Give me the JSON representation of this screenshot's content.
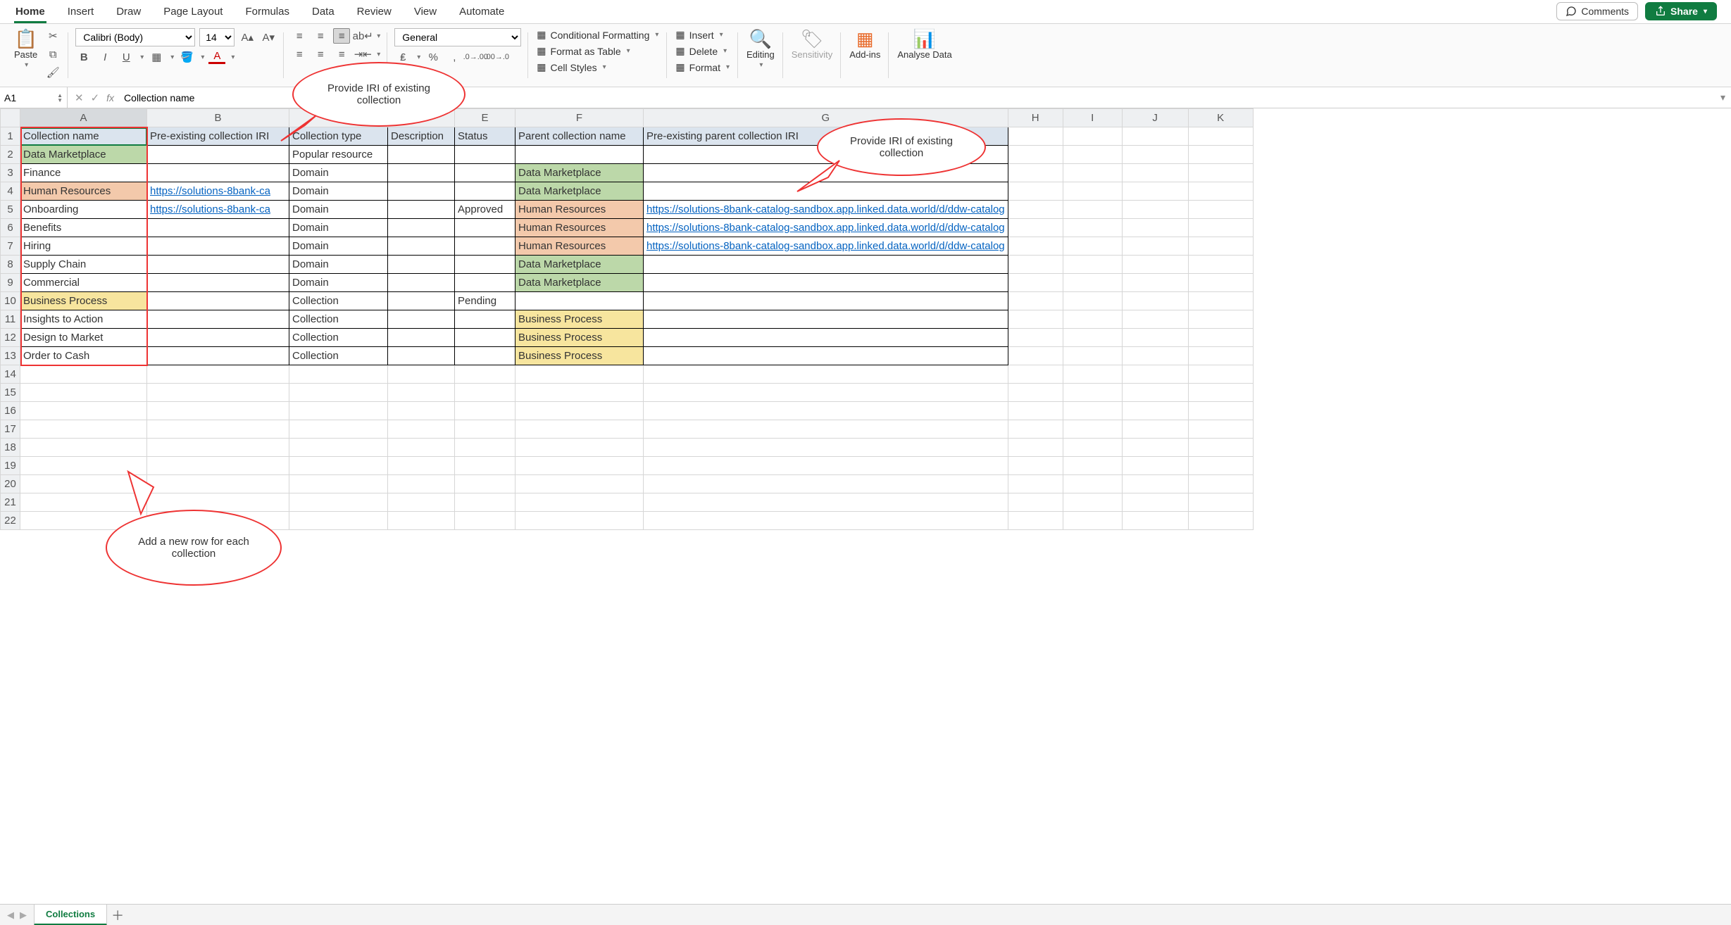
{
  "tabs": [
    "Home",
    "Insert",
    "Draw",
    "Page Layout",
    "Formulas",
    "Data",
    "Review",
    "View",
    "Automate"
  ],
  "active_tab": "Home",
  "top_right": {
    "comments": "Comments",
    "share": "Share"
  },
  "ribbon": {
    "paste": "Paste",
    "font_name": "Calibri (Body)",
    "font_size": "14",
    "number_format": "General",
    "styles": {
      "cond_fmt": "Conditional Formatting",
      "as_table": "Format as Table",
      "cell_styles": "Cell Styles"
    },
    "cells": {
      "insert": "Insert",
      "delete": "Delete",
      "format": "Format"
    },
    "editing": "Editing",
    "sensitivity": "Sensitivity",
    "addins": "Add-ins",
    "analyse": "Analyse Data"
  },
  "formula_bar": {
    "cell_ref": "A1",
    "formula": "Collection name"
  },
  "columns": [
    "A",
    "B",
    "C",
    "D",
    "E",
    "F",
    "G",
    "H",
    "I",
    "J",
    "K"
  ],
  "row_count": 22,
  "headers": {
    "A": "Collection name",
    "B": "Pre-existing collection IRI",
    "C": "Collection type",
    "D": "Description",
    "E": "Status",
    "F": "Parent collection name",
    "G": "Pre-existing parent collection IRI"
  },
  "data_rows": [
    {
      "A": {
        "v": "Data Marketplace",
        "fill": "green"
      },
      "C": {
        "v": "Popular resource"
      }
    },
    {
      "A": {
        "v": "Finance"
      },
      "C": {
        "v": "Domain"
      },
      "F": {
        "v": "Data Marketplace",
        "fill": "green"
      }
    },
    {
      "A": {
        "v": "Human Resources",
        "fill": "orange"
      },
      "B": {
        "v": "https://solutions-8bank-ca",
        "link": true
      },
      "C": {
        "v": "Domain"
      },
      "F": {
        "v": "Data Marketplace",
        "fill": "green"
      }
    },
    {
      "A": {
        "v": "Onboarding"
      },
      "B": {
        "v": "https://solutions-8bank-ca",
        "link": true
      },
      "C": {
        "v": "Domain"
      },
      "E": {
        "v": "Approved"
      },
      "F": {
        "v": "Human Resources",
        "fill": "orange"
      },
      "G": {
        "v": "https://solutions-8bank-catalog-sandbox.app.linked.data.world/d/ddw-catalog",
        "link": true
      }
    },
    {
      "A": {
        "v": "Benefits"
      },
      "C": {
        "v": "Domain"
      },
      "F": {
        "v": "Human Resources",
        "fill": "orange"
      },
      "G": {
        "v": "https://solutions-8bank-catalog-sandbox.app.linked.data.world/d/ddw-catalog",
        "link": true
      }
    },
    {
      "A": {
        "v": "Hiring"
      },
      "C": {
        "v": "Domain"
      },
      "F": {
        "v": "Human Resources",
        "fill": "orange"
      },
      "G": {
        "v": "https://solutions-8bank-catalog-sandbox.app.linked.data.world/d/ddw-catalog",
        "link": true
      }
    },
    {
      "A": {
        "v": "Supply Chain"
      },
      "C": {
        "v": "Domain"
      },
      "F": {
        "v": "Data Marketplace",
        "fill": "green"
      }
    },
    {
      "A": {
        "v": "Commercial"
      },
      "C": {
        "v": "Domain"
      },
      "F": {
        "v": "Data Marketplace",
        "fill": "green"
      }
    },
    {
      "A": {
        "v": "Business Process",
        "fill": "yellow"
      },
      "C": {
        "v": "Collection"
      },
      "E": {
        "v": "Pending"
      }
    },
    {
      "A": {
        "v": "Insights to Action"
      },
      "C": {
        "v": "Collection"
      },
      "F": {
        "v": "Business Process",
        "fill": "yellow"
      }
    },
    {
      "A": {
        "v": "Design to Market"
      },
      "C": {
        "v": "Collection"
      },
      "F": {
        "v": "Business Process",
        "fill": "yellow"
      }
    },
    {
      "A": {
        "v": "Order to Cash"
      },
      "C": {
        "v": "Collection"
      },
      "F": {
        "v": "Business Process",
        "fill": "yellow"
      }
    }
  ],
  "callouts": {
    "top": "Provide IRI of existing collection",
    "right": "Provide IRI of existing collection",
    "bottom": "Add a new row for each collection"
  },
  "sheet_tab": "Collections"
}
